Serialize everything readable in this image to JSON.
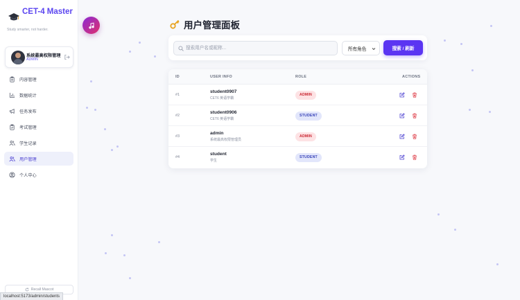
{
  "brand": {
    "title": "CET-4 Master",
    "subtitle": "Study smarter, not harder."
  },
  "user": {
    "name": "系统最高权限管理员",
    "role": "ADMIN"
  },
  "nav": [
    {
      "label": "内容管理",
      "icon": "clipboard-icon",
      "active": false
    },
    {
      "label": "数据统计",
      "icon": "bar-chart-icon",
      "active": false
    },
    {
      "label": "任务发布",
      "icon": "megaphone-icon",
      "active": false
    },
    {
      "label": "考试管理",
      "icon": "clipboard-check-icon",
      "active": false
    },
    {
      "label": "学生记录",
      "icon": "users-icon",
      "active": false
    },
    {
      "label": "用户管理",
      "icon": "users-icon",
      "active": true
    },
    {
      "label": "个人中心",
      "icon": "user-circle-icon",
      "active": false
    }
  ],
  "recall": {
    "label": "Recall Mascot"
  },
  "status_url": "localhost:5173/admin/students",
  "page": {
    "title": "用户管理面板"
  },
  "toolbar": {
    "search_placeholder": "搜索用户名或昵称...",
    "search_value": "",
    "role_filter": "所有角色",
    "button_label": "搜索 / 刷新"
  },
  "table": {
    "columns": [
      "ID",
      "USER INFO",
      "ROLE",
      "ACTIONS"
    ],
    "rows": [
      {
        "id": "#1",
        "username": "student0907",
        "nickname": "CET6 英语学霸",
        "role": "ADMIN"
      },
      {
        "id": "#2",
        "username": "student0906",
        "nickname": "CET6 英语学霸",
        "role": "STUDENT"
      },
      {
        "id": "#3",
        "username": "admin",
        "nickname": "系统最高权限管理员",
        "role": "ADMIN"
      },
      {
        "id": "#4",
        "username": "student",
        "nickname": "学生",
        "role": "STUDENT"
      }
    ]
  },
  "colors": {
    "accent": "#5b35f2",
    "brand": "#5b45f0",
    "admin_badge_bg": "#fde2e4",
    "admin_badge_text": "#c9242f",
    "student_badge_bg": "#e2e6fb",
    "student_badge_text": "#3742b8",
    "edit_icon": "#4b3fd1",
    "delete_icon": "#e0454f"
  }
}
